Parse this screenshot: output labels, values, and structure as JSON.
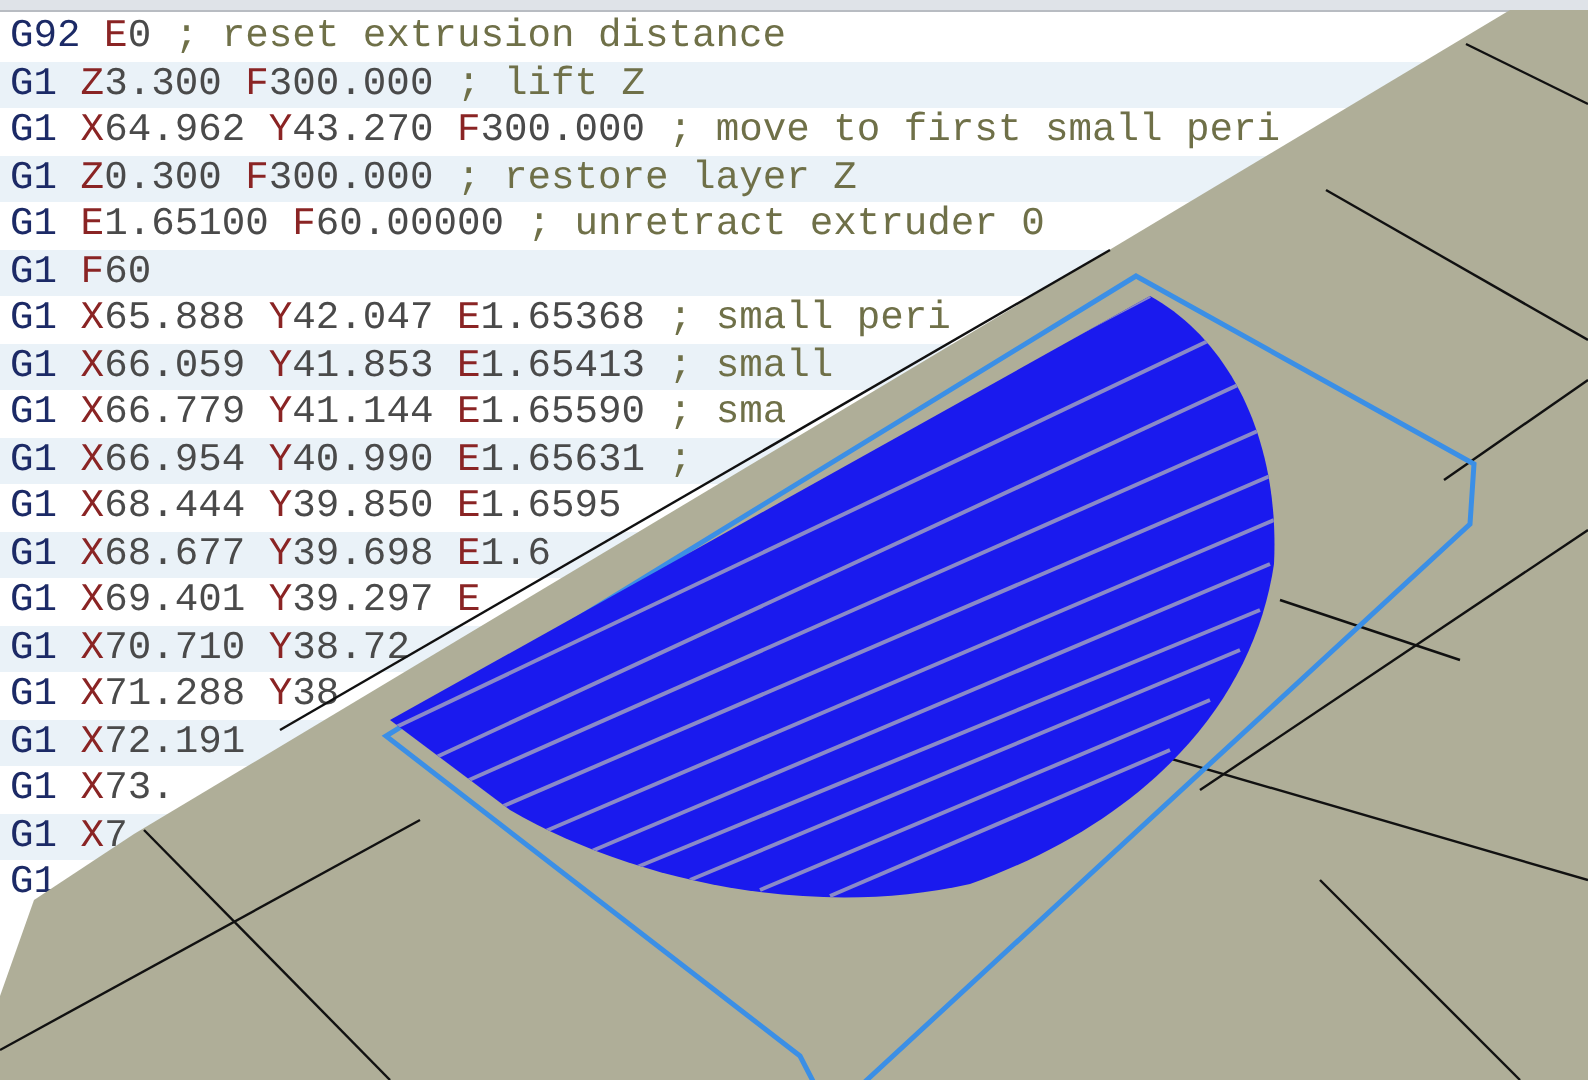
{
  "code_editor": {
    "lines": [
      "G92 E0 ; reset extrusion distance",
      "G1 Z3.300 F300.000 ; lift Z",
      "G1 X64.962 Y43.270 F300.000 ; move to first small peri",
      "G1 Z0.300 F300.000 ; restore layer Z",
      "G1 E1.65100 F60.00000 ; unretract extruder 0",
      "G1 F60",
      "G1 X65.888 Y42.047 E1.65368 ; small peri",
      "G1 X66.059 Y41.853 E1.65413 ; small",
      "G1 X66.779 Y41.144 E1.65590 ; sma",
      "G1 X66.954 Y40.990 E1.65631 ;",
      "G1 X68.444 Y39.850 E1.6595",
      "G1 X68.677 Y39.698 E1.6",
      "G1 X69.401 Y39.297 E",
      "G1 X70.710 Y38.72",
      "G1 X71.288 Y38",
      "G1 X72.191",
      "G1 X73.",
      "G1 X7",
      "G1"
    ]
  }
}
